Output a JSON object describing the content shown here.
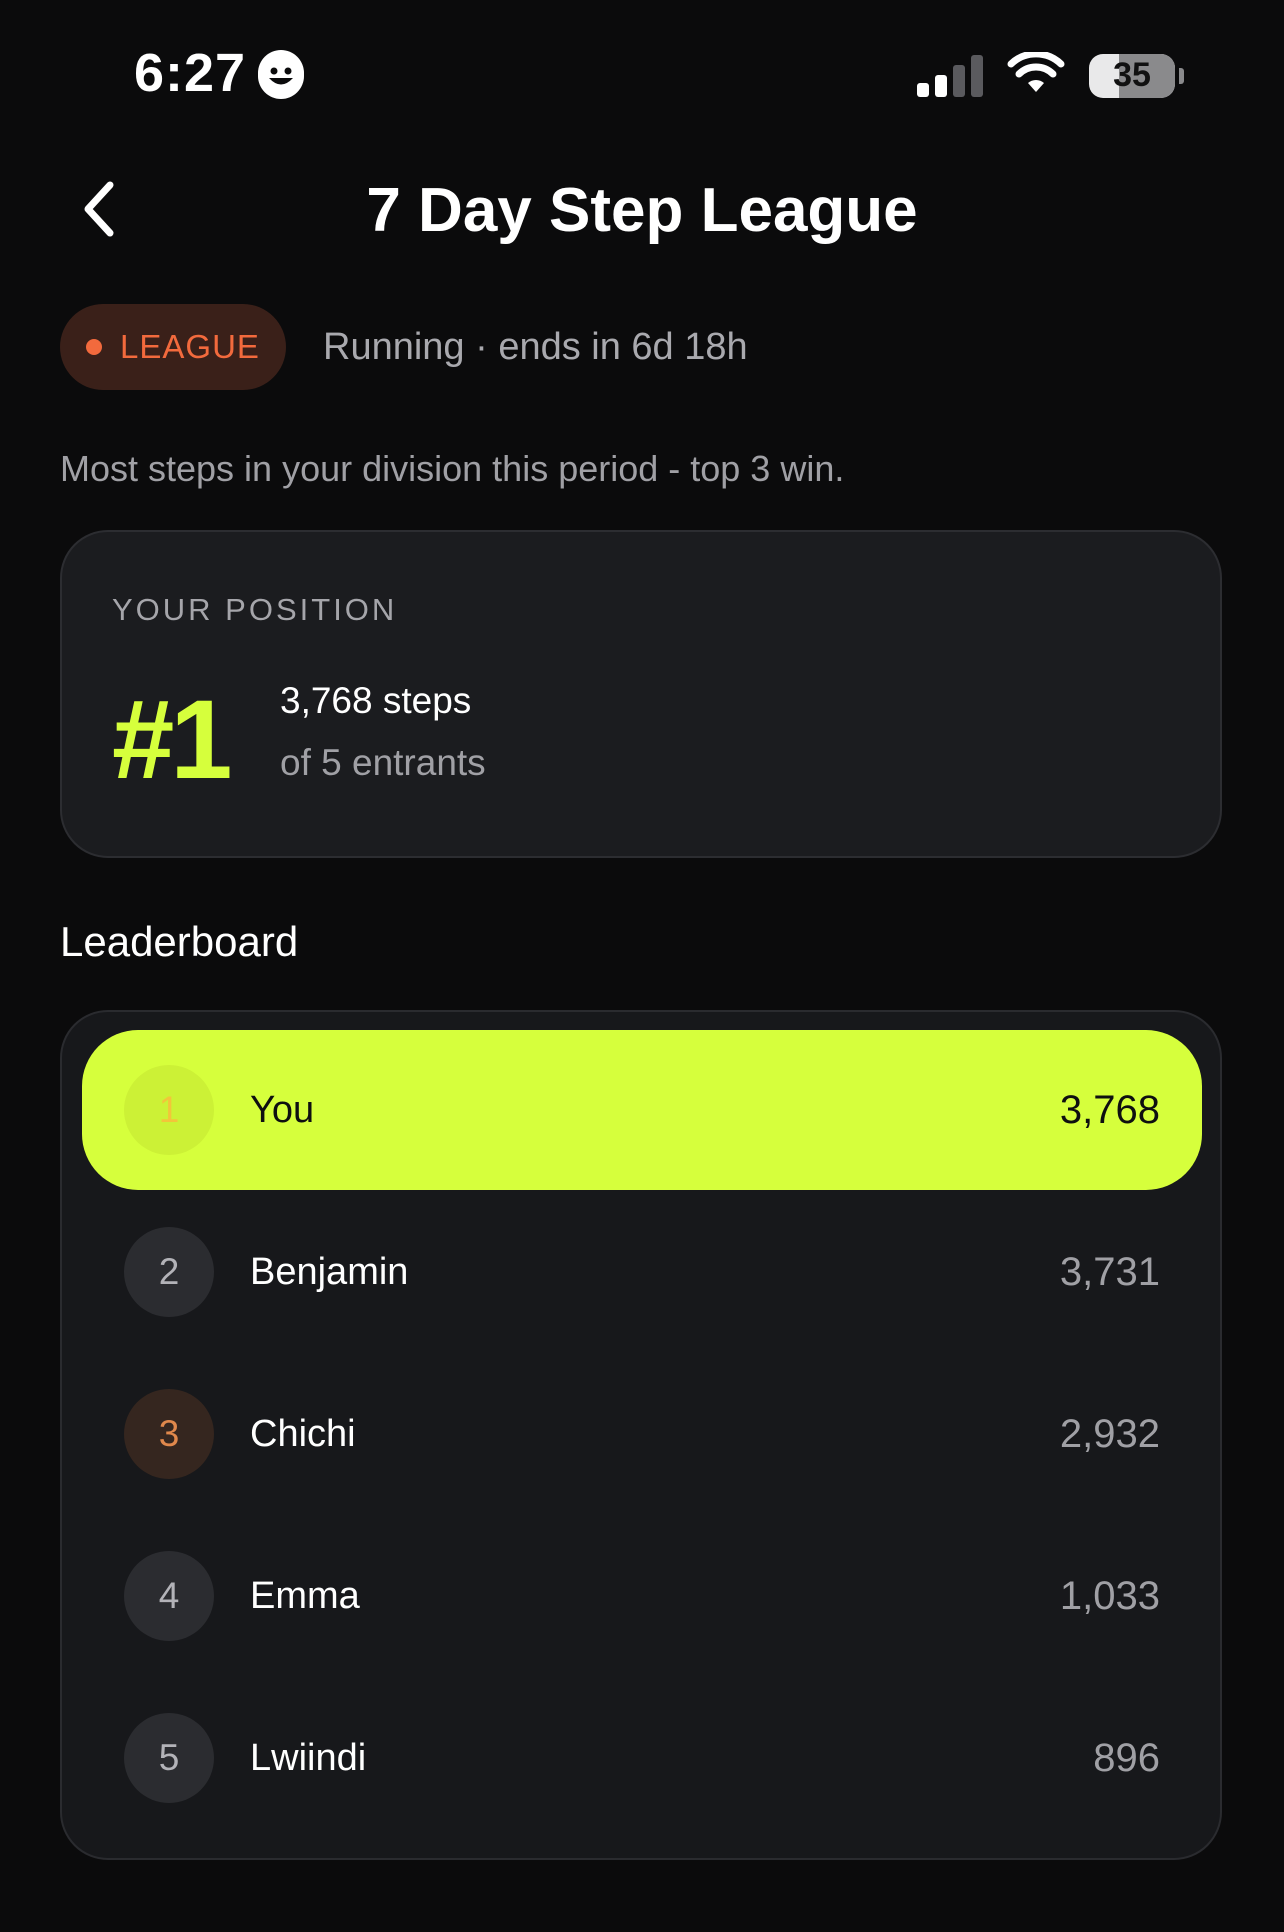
{
  "status_bar": {
    "time": "6:27",
    "battery": "35"
  },
  "header": {
    "title": "7 Day Step League"
  },
  "league": {
    "badge_label": "LEAGUE",
    "status": "Running · ends in 6d 18h",
    "description": "Most steps in your division this period - top 3 win."
  },
  "position": {
    "label": "YOUR POSITION",
    "rank": "#1",
    "steps": "3,768 steps",
    "entrants": "of 5 entrants"
  },
  "leaderboard": {
    "title": "Leaderboard",
    "rows": [
      {
        "rank": "1",
        "name": "You",
        "steps": "3,768"
      },
      {
        "rank": "2",
        "name": "Benjamin",
        "steps": "3,731"
      },
      {
        "rank": "3",
        "name": "Chichi",
        "steps": "2,932"
      },
      {
        "rank": "4",
        "name": "Emma",
        "steps": "1,033"
      },
      {
        "rank": "5",
        "name": "Lwiindi",
        "steps": "896"
      }
    ]
  },
  "colors": {
    "accent": "#d6ff3c",
    "league_orange": "#f26a3d",
    "background": "#0b0b0c",
    "card": "#1b1c1f"
  }
}
